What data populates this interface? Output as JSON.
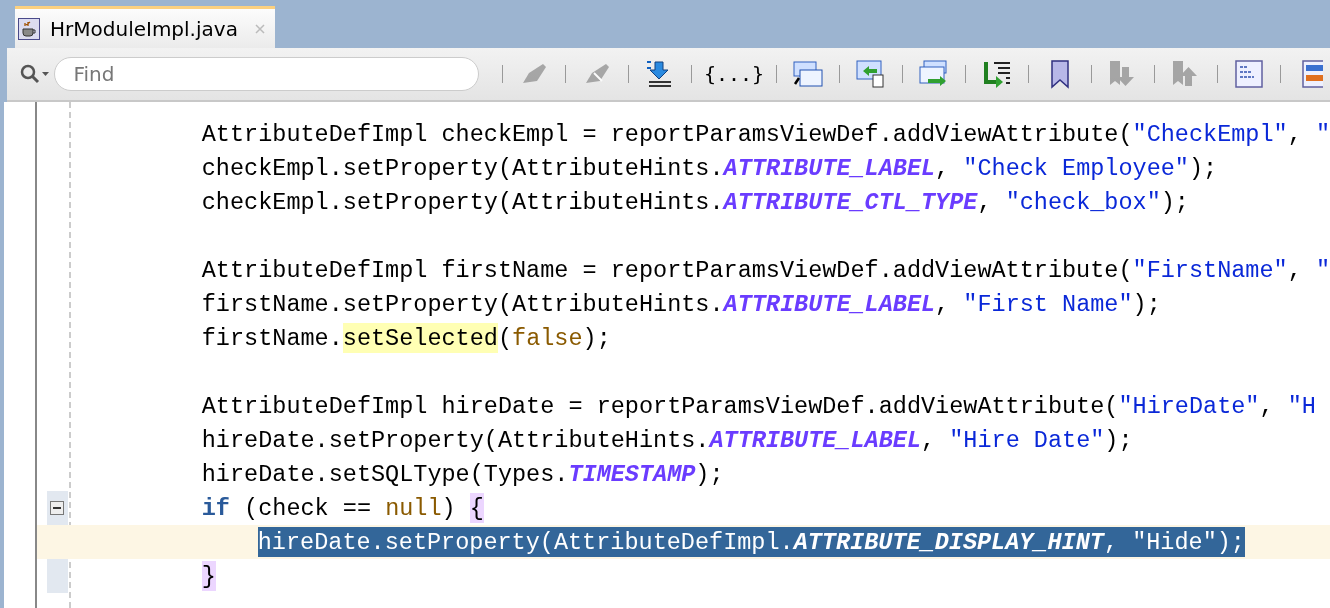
{
  "tab": {
    "label": "HrModuleImpl.java",
    "selected": true
  },
  "toolbar": {
    "search": {
      "placeholder": "Find"
    },
    "buttons": [
      {
        "kind": "highlight",
        "disabled": true
      },
      {
        "kind": "highlight-off",
        "disabled": true
      },
      {
        "kind": "jump",
        "disabled": false
      },
      {
        "kind": "braces",
        "label": "{...}",
        "disabled": false
      },
      {
        "kind": "numbered",
        "disabled": false
      },
      {
        "kind": "back",
        "disabled": false
      },
      {
        "kind": "forward",
        "disabled": false
      },
      {
        "kind": "goto",
        "disabled": false
      },
      {
        "kind": "bookmark",
        "disabled": false
      },
      {
        "kind": "next-bookmark",
        "disabled": true
      },
      {
        "kind": "prev-bookmark",
        "disabled": true
      },
      {
        "kind": "panel",
        "disabled": false
      },
      {
        "kind": "split",
        "disabled": false
      }
    ]
  },
  "lines": [
    {
      "kind": "code",
      "selected": false,
      "tokens": [
        {
          "kind": "plain",
          "text": "AttributeDefImpl checkEmpl = reportParamsViewDef.addViewAttribute("
        },
        {
          "kind": "string",
          "text": "\"CheckEmpl\""
        },
        {
          "kind": "plain",
          "text": ", "
        },
        {
          "kind": "string",
          "text": "\""
        }
      ]
    },
    {
      "kind": "code",
      "selected": false,
      "tokens": [
        {
          "kind": "plain",
          "text": "checkEmpl.setProperty(AttributeHints."
        },
        {
          "kind": "constant",
          "text": "ATTRIBUTE_LABEL"
        },
        {
          "kind": "plain",
          "text": ", "
        },
        {
          "kind": "string",
          "text": "\"Check Employee\""
        },
        {
          "kind": "plain",
          "text": ");"
        }
      ]
    },
    {
      "kind": "code",
      "selected": false,
      "tokens": [
        {
          "kind": "plain",
          "text": "checkEmpl.setProperty(AttributeHints."
        },
        {
          "kind": "constant",
          "text": "ATTRIBUTE_CTL_TYPE"
        },
        {
          "kind": "plain",
          "text": ", "
        },
        {
          "kind": "string",
          "text": "\"check_box\""
        },
        {
          "kind": "plain",
          "text": ");"
        }
      ]
    },
    {
      "kind": "blank"
    },
    {
      "kind": "code",
      "selected": false,
      "tokens": [
        {
          "kind": "plain",
          "text": "AttributeDefImpl firstName = reportParamsViewDef.addViewAttribute("
        },
        {
          "kind": "string",
          "text": "\"FirstName\""
        },
        {
          "kind": "plain",
          "text": ", "
        },
        {
          "kind": "string",
          "text": "\""
        }
      ]
    },
    {
      "kind": "code",
      "selected": false,
      "tokens": [
        {
          "kind": "plain",
          "text": "firstName.setProperty(AttributeHints."
        },
        {
          "kind": "constant",
          "text": "ATTRIBUTE_LABEL"
        },
        {
          "kind": "plain",
          "text": ", "
        },
        {
          "kind": "string",
          "text": "\"First Name\""
        },
        {
          "kind": "plain",
          "text": ");"
        }
      ]
    },
    {
      "kind": "code",
      "selected": false,
      "tokens": [
        {
          "kind": "plain",
          "text": "firstName."
        },
        {
          "kind": "occurrence",
          "text": "setSelected"
        },
        {
          "kind": "plain",
          "text": "("
        },
        {
          "kind": "literal",
          "text": "false"
        },
        {
          "kind": "plain",
          "text": ");"
        }
      ]
    },
    {
      "kind": "blank"
    },
    {
      "kind": "code",
      "selected": false,
      "tokens": [
        {
          "kind": "plain",
          "text": "AttributeDefImpl hireDate = reportParamsViewDef.addViewAttribute("
        },
        {
          "kind": "string",
          "text": "\"HireDate\""
        },
        {
          "kind": "plain",
          "text": ", "
        },
        {
          "kind": "string",
          "text": "\"H"
        }
      ]
    },
    {
      "kind": "code",
      "selected": false,
      "tokens": [
        {
          "kind": "plain",
          "text": "hireDate.setProperty(AttributeHints."
        },
        {
          "kind": "constant",
          "text": "ATTRIBUTE_LABEL"
        },
        {
          "kind": "plain",
          "text": ", "
        },
        {
          "kind": "string",
          "text": "\"Hire Date\""
        },
        {
          "kind": "plain",
          "text": ");"
        }
      ]
    },
    {
      "kind": "code",
      "selected": false,
      "tokens": [
        {
          "kind": "plain",
          "text": "hireDate.setSQLType(Types."
        },
        {
          "kind": "constant",
          "text": "TIMESTAMP"
        },
        {
          "kind": "plain",
          "text": ");"
        }
      ]
    },
    {
      "kind": "block",
      "expanded": true,
      "header": [
        {
          "kind": "keyword",
          "text": "if"
        },
        {
          "kind": "plain",
          "text": " (check == "
        },
        {
          "kind": "literal",
          "text": "null"
        },
        {
          "kind": "plain",
          "text": ") "
        },
        {
          "kind": "brace",
          "text": "{"
        }
      ],
      "children": [
        {
          "kind": "code",
          "selected": true,
          "tokens": [
            {
              "kind": "plain",
              "text": "hireDate.setProperty(AttributeDefImpl."
            },
            {
              "kind": "constant",
              "text": "ATTRIBUTE_DISPLAY_HINT"
            },
            {
              "kind": "plain",
              "text": ", "
            },
            {
              "kind": "string",
              "text": "\"Hide\""
            },
            {
              "kind": "plain",
              "text": ");"
            }
          ]
        }
      ],
      "closing": [
        {
          "kind": "brace",
          "text": "}"
        }
      ]
    }
  ]
}
